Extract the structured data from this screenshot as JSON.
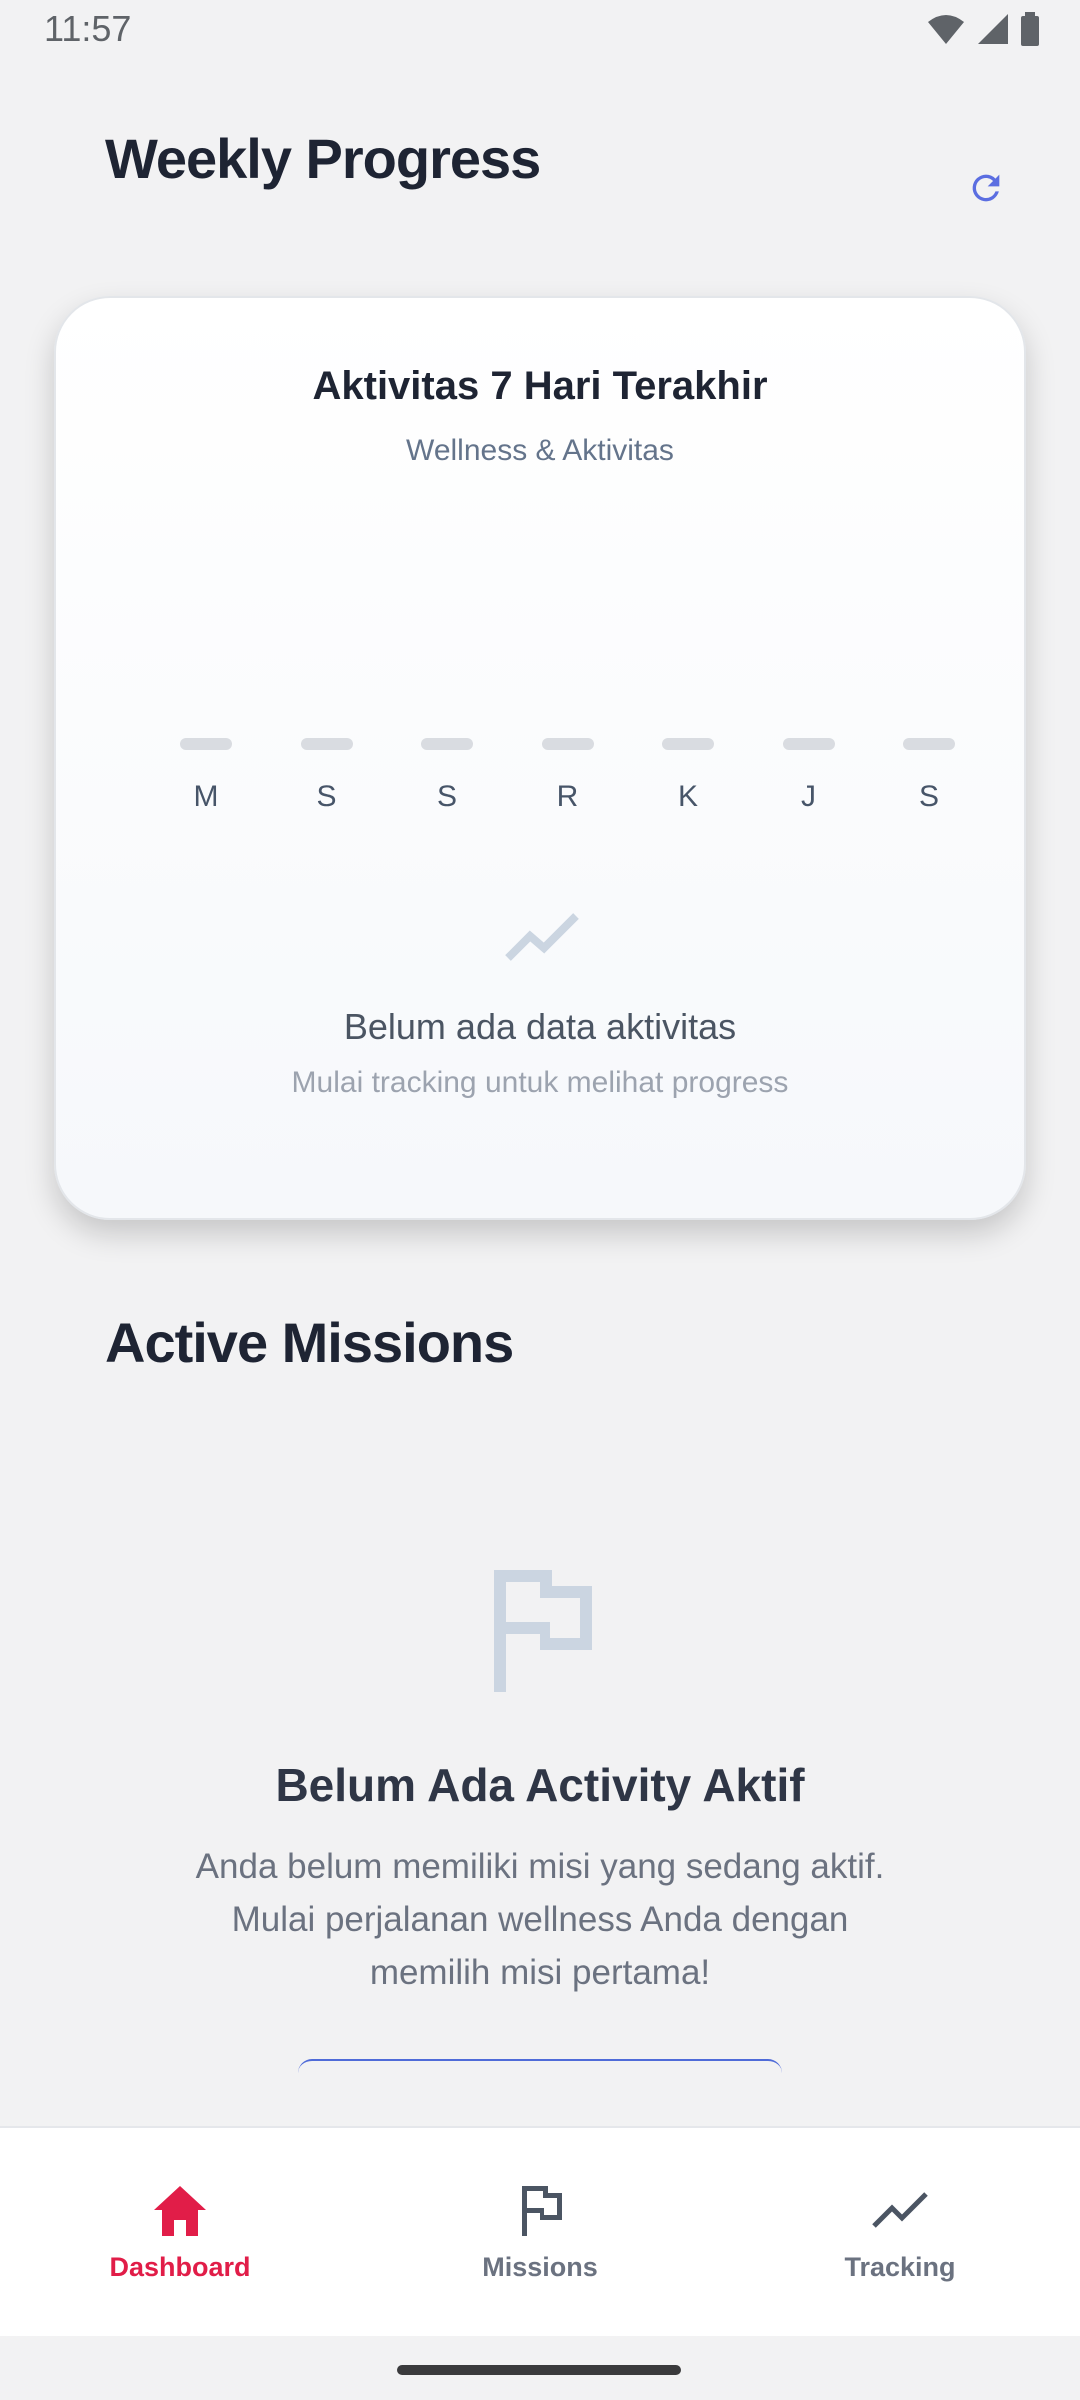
{
  "status_bar": {
    "time": "11:57"
  },
  "header": {
    "title": "Weekly Progress",
    "refresh_icon": "refresh-icon"
  },
  "chart_card": {
    "title": "Aktivitas 7 Hari Terakhir",
    "subtitle": "Wellness & Aktivitas",
    "empty_title": "Belum ada data aktivitas",
    "empty_subtitle": "Mulai tracking untuk melihat progress"
  },
  "chart_data": {
    "type": "bar",
    "title": "Aktivitas 7 Hari Terakhir",
    "subtitle": "Wellness & Aktivitas",
    "categories": [
      "M",
      "S",
      "S",
      "R",
      "K",
      "J",
      "S"
    ],
    "values": [
      0,
      0,
      0,
      0,
      0,
      0,
      0
    ],
    "xlabel": "",
    "ylabel": "",
    "grid": false
  },
  "missions": {
    "title": "Active Missions",
    "empty_title": "Belum Ada Activity Aktif",
    "empty_desc_lines": [
      "Anda belum memiliki misi yang sedang aktif.",
      "Mulai perjalanan wellness Anda dengan",
      "memilih misi pertama!"
    ]
  },
  "nav": {
    "items": [
      {
        "label": "Dashboard",
        "icon": "home-icon",
        "active": true
      },
      {
        "label": "Missions",
        "icon": "flag-icon",
        "active": false
      },
      {
        "label": "Tracking",
        "icon": "trending-icon",
        "active": false
      }
    ]
  },
  "colors": {
    "accent": "#e11d48",
    "primary_blue": "#4f6bd8",
    "background": "#f2f2f3"
  }
}
